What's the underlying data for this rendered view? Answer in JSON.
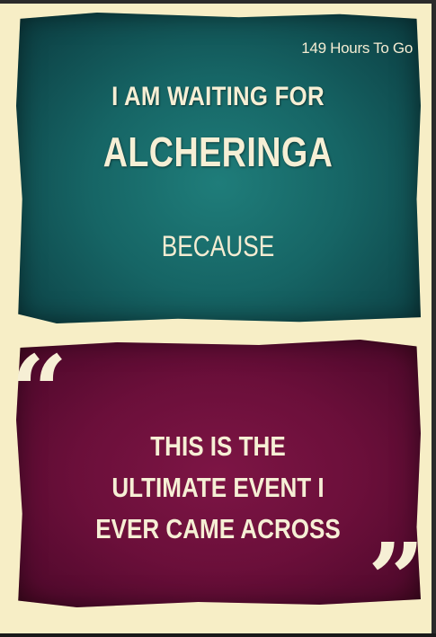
{
  "countdown": "149 Hours To Go",
  "headline": {
    "line1": "I AM WAITING FOR",
    "line2": "ALCHERINGA",
    "because": "BECAUSE"
  },
  "quote": {
    "open_mark": "“",
    "lines": [
      "THIS IS THE",
      "ULTIMATE EVENT I",
      "EVER CAME ACROSS"
    ],
    "close_mark": "”"
  },
  "colors": {
    "background": "#f7eec6",
    "top_panel": "#166565",
    "bottom_panel": "#6b0f3a",
    "text": "#f6efd5"
  }
}
